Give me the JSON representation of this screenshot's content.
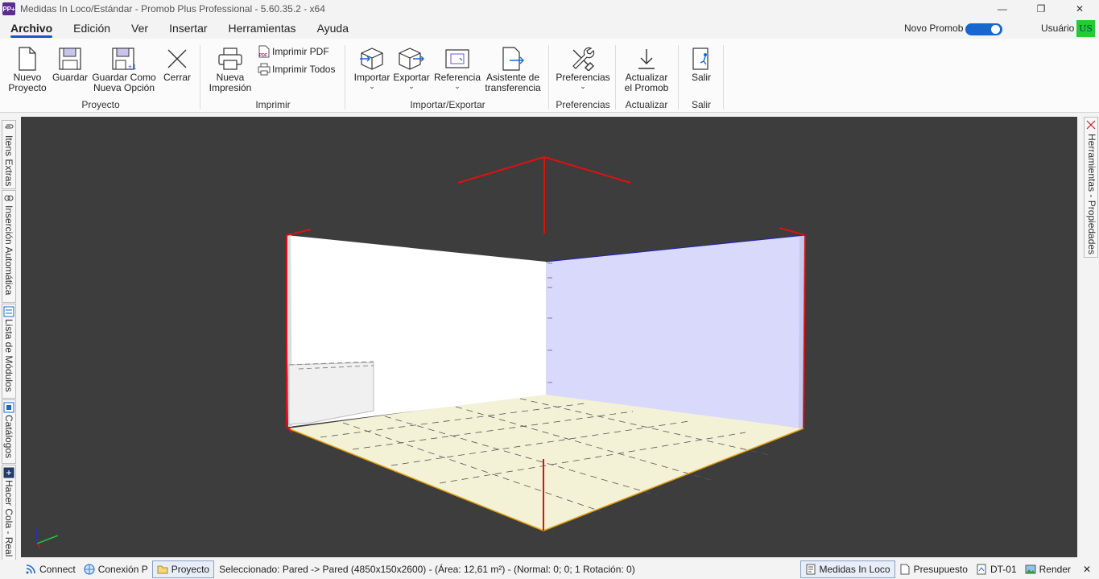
{
  "window": {
    "title": "Medidas In Loco/Estándar - Promob Plus Professional - 5.60.35.2 - x64",
    "app_icon_text": "PP+",
    "controls": [
      "—",
      "❐",
      "✕"
    ]
  },
  "menu": {
    "items": [
      "Archivo",
      "Edición",
      "Ver",
      "Insertar",
      "Herramientas",
      "Ayuda"
    ],
    "novo_promob_label": "Novo Promob",
    "user_label": "Usuário",
    "user_badge": "US"
  },
  "ribbon": {
    "proyecto": {
      "nuevo": "Nuevo\nProyecto",
      "guardar": "Guardar",
      "guardar_como": "Guardar Como\nNueva Opción",
      "cerrar": "Cerrar",
      "label": "Proyecto"
    },
    "imprimir": {
      "nueva": "Nueva\nImpresión",
      "pdf": "Imprimir PDF",
      "todos": "Imprimir Todos",
      "label": "Imprimir"
    },
    "importar_exportar": {
      "importar": "Importar",
      "exportar": "Exportar",
      "referencia": "Referencia",
      "asistente": "Asistente de\ntransferencia",
      "label": "Importar/Exportar"
    },
    "preferencias": {
      "btn": "Preferencias",
      "label": "Preferencias"
    },
    "actualizar": {
      "btn": "Actualizar\nel Promob",
      "label": "Actualizar"
    },
    "salir": {
      "btn": "Salir",
      "label": "Salir"
    }
  },
  "left_tabs": [
    "Itens Extras",
    "Inserción Automática",
    "Lista de Módulos",
    "Catálogos",
    "Hacer Cola - Real Sc"
  ],
  "right_tab": "Herramientas - Propiedades",
  "statusbar": {
    "connect": "Connect",
    "conexion": "Conexión P",
    "proyecto": "Proyecto",
    "status": "Seleccionado: Pared -> Pared (4850x150x2600) - (Área: 12,61 m²) - (Normal: 0; 0; 1 Rotación: 0)",
    "medidas": "Medidas In Loco",
    "presupuesto": "Presupuesto",
    "dt": "DT-01",
    "render": "Render",
    "close": "✕"
  },
  "colors": {
    "accent": "#1767d1",
    "viewport_bg": "#3d3d3d",
    "wall_right": "#d9d9fb",
    "floor": "#f3f1d6",
    "edge_red": "#e01010"
  }
}
